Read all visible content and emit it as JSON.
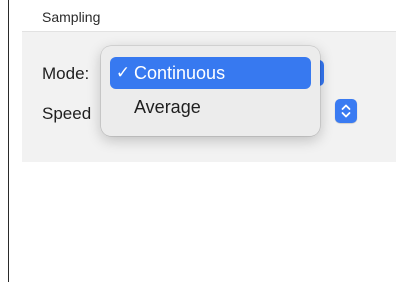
{
  "section": {
    "title": "Sampling"
  },
  "rows": {
    "mode_label": "Mode:",
    "speed_label": "Speed"
  },
  "dropdown": {
    "options": [
      {
        "label": "Continuous",
        "selected": true,
        "check": "✓"
      },
      {
        "label": "Average",
        "selected": false
      }
    ]
  },
  "colors": {
    "accent": "#3779f0",
    "panel_background": "#f2f2f2",
    "menu_background": "#ececec"
  },
  "icons": {
    "check": "checkmark-icon",
    "stepper": "up-down-chevrons-icon"
  }
}
